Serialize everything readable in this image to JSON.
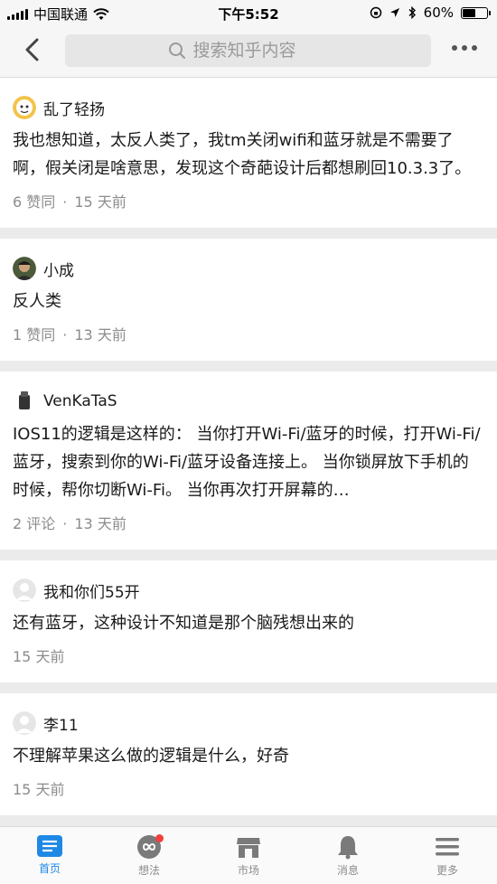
{
  "status_bar": {
    "carrier": "中国联通",
    "time": "下午5:52",
    "battery": "60%",
    "battery_level": 0.6
  },
  "nav": {
    "search_placeholder": "搜索知乎内容"
  },
  "comments": [
    {
      "author": "乱了轻扬",
      "content": "我也想知道，太反人类了，我tm关闭wifi和蓝牙就是不需要了啊，假关闭是啥意思，发现这个奇葩设计后都想刷回10.3.3了。",
      "stat": "6 赞同",
      "time": "15 天前",
      "avatar_color": "#f3c34a"
    },
    {
      "author": "小成",
      "content": "反人类",
      "stat": "1 赞同",
      "time": "13 天前",
      "avatar_color": "#4a5a3a"
    },
    {
      "author": "VenKaTaS",
      "content": "IOS11的逻辑是这样的： 当你打开Wi-Fi/蓝牙的时候，打开Wi-Fi/蓝牙，搜索到你的Wi-Fi/蓝牙设备连接上。 当你锁屏放下手机的时候，帮你切断Wi-Fi。 当你再次打开屏幕的…",
      "stat": "2 评论",
      "time": "13 天前",
      "avatar_color": "#333333"
    },
    {
      "author": "我和你们55开",
      "content": "还有蓝牙，这种设计不知道是那个脑残想出来的",
      "stat": "",
      "time": "15 天前",
      "avatar_color": "#dddddd"
    },
    {
      "author": "李11",
      "content": "不理解苹果这么做的逻辑是什么，好奇",
      "stat": "",
      "time": "15 天前",
      "avatar_color": "#dddddd"
    }
  ],
  "tabs": [
    {
      "label": "首页",
      "icon": "home-icon"
    },
    {
      "label": "想法",
      "icon": "ideas-icon"
    },
    {
      "label": "市场",
      "icon": "market-icon"
    },
    {
      "label": "消息",
      "icon": "bell-icon"
    },
    {
      "label": "更多",
      "icon": "menu-icon"
    }
  ],
  "colors": {
    "accent": "#1e88e5",
    "badge": "#f1403c"
  }
}
